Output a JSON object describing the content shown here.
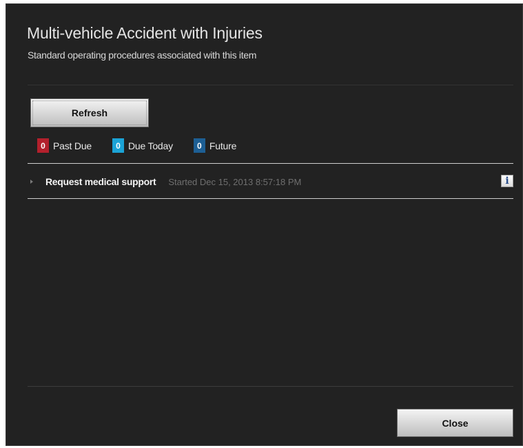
{
  "dialog": {
    "title": "Multi-vehicle Accident with Injuries",
    "subtitle": "Standard operating procedures associated with this item"
  },
  "toolbar": {
    "refresh_label": "Refresh"
  },
  "counters": [
    {
      "count": "0",
      "label": "Past Due",
      "color": "#b3202c"
    },
    {
      "count": "0",
      "label": "Due Today",
      "color": "#1ba3d6"
    },
    {
      "count": "0",
      "label": "Future",
      "color": "#1d5f94"
    }
  ],
  "tasks": [
    {
      "name": "Request medical support",
      "status": "Started Dec 15, 2013 8:57:18 PM",
      "info_icon": "info-icon"
    }
  ],
  "footer": {
    "close_label": "Close"
  }
}
